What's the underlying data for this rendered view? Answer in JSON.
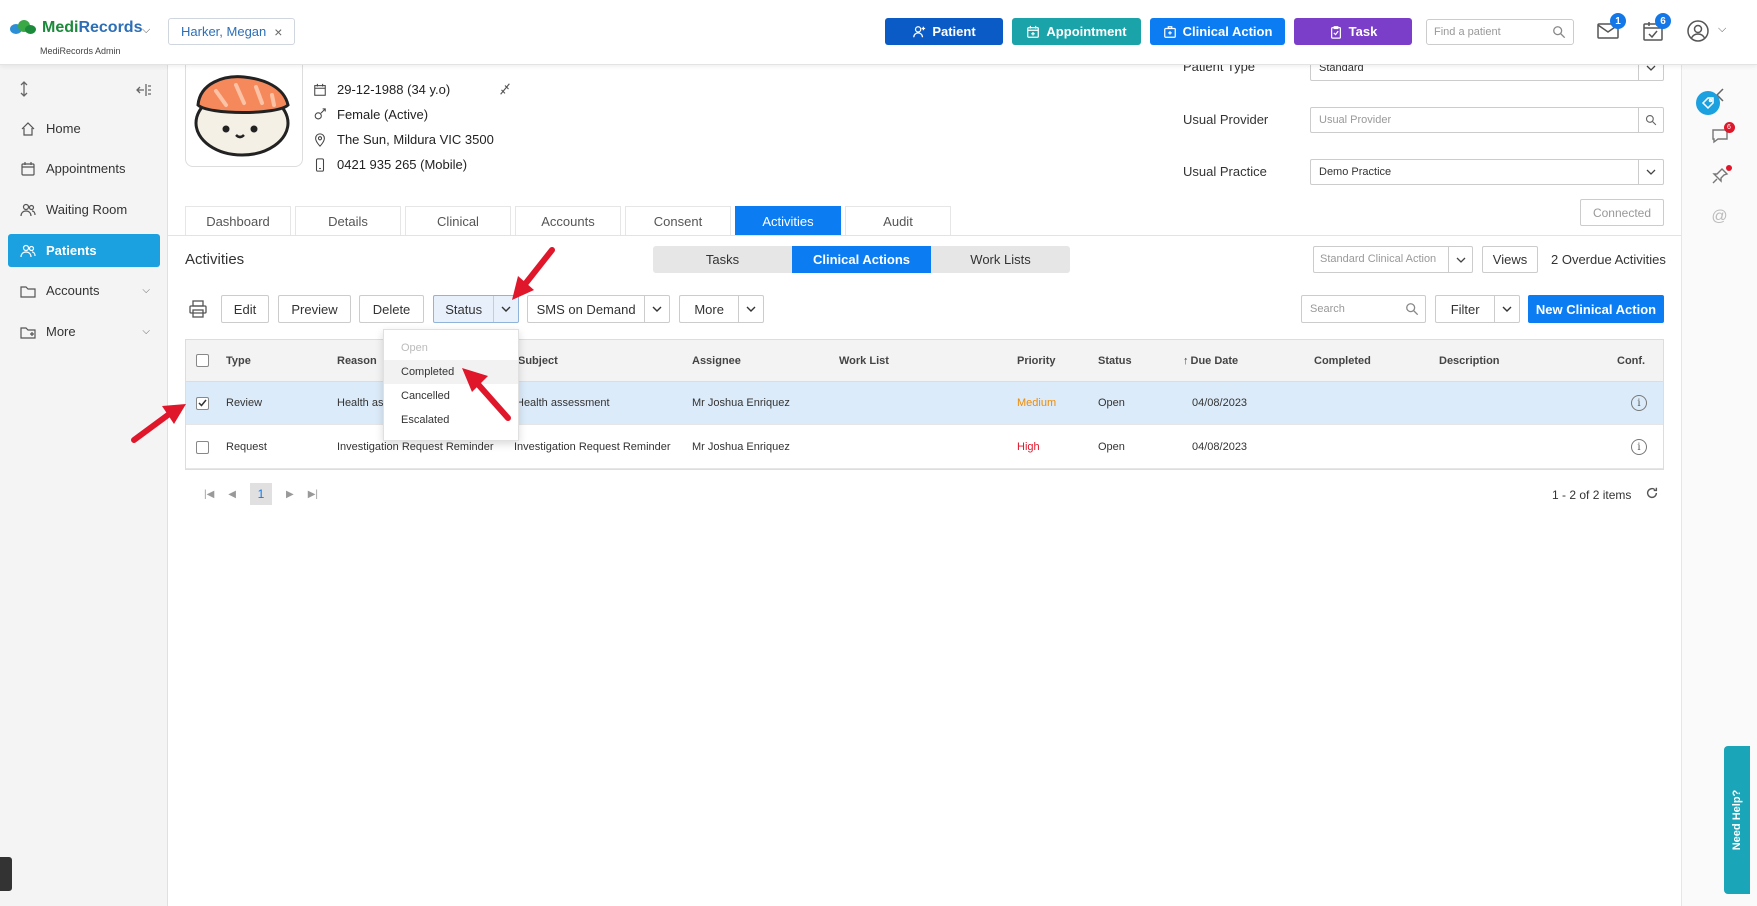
{
  "header": {
    "logo_part1": "Medi",
    "logo_part2": "Records",
    "logo_subtitle": "MediRecords Admin",
    "patient_chip": "Harker, Megan",
    "buttons": {
      "patient": "Patient",
      "appointment": "Appointment",
      "clinical_action": "Clinical Action",
      "task": "Task"
    },
    "find_placeholder": "Find a patient",
    "mail_count": "1",
    "tasks_count": "6",
    "colors": {
      "patient": "#0b5bc6",
      "appointment": "#1aa3a8",
      "clinical_action": "#0b7cf2",
      "task": "#7a3ec8"
    }
  },
  "sidebar": {
    "items": [
      {
        "label": "Home",
        "icon": "home-icon"
      },
      {
        "label": "Appointments",
        "icon": "calendar-icon"
      },
      {
        "label": "Waiting Room",
        "icon": "people-icon"
      },
      {
        "label": "Patients",
        "icon": "patients-icon"
      },
      {
        "label": "Accounts",
        "icon": "folder-icon"
      },
      {
        "label": "More",
        "icon": "more-icon"
      }
    ]
  },
  "patient": {
    "name": "Harker, Megan",
    "dob": "29-12-1988 (34 y.o)",
    "gender": "Female (Active)",
    "address": "The Sun, Mildura VIC 3500",
    "phone": "0421 935 265 (Mobile)",
    "patient_type_label": "Patient Type",
    "patient_type_value": "Standard",
    "usual_provider_label": "Usual Provider",
    "usual_provider_placeholder": "Usual Provider",
    "usual_practice_label": "Usual Practice",
    "usual_practice_value": "Demo Practice",
    "connected": "Connected"
  },
  "tabs": [
    "Dashboard",
    "Details",
    "Clinical",
    "Accounts",
    "Consent",
    "Activities",
    "Audit"
  ],
  "activities": {
    "title": "Activities",
    "segments": [
      "Tasks",
      "Clinical Actions",
      "Work Lists"
    ],
    "clinical_action_type": "Standard Clinical Action",
    "views": "Views",
    "overdue": "2 Overdue Activities",
    "toolbar": {
      "edit": "Edit",
      "preview": "Preview",
      "delete": "Delete",
      "status": "Status",
      "sms": "SMS on Demand",
      "more": "More",
      "search_placeholder": "Search",
      "filter": "Filter",
      "new_clinical_action": "New Clinical Action"
    },
    "status_options": [
      "Open",
      "Completed",
      "Cancelled",
      "Escalated"
    ],
    "columns": [
      "Type",
      "Reason",
      "Subject",
      "Assignee",
      "Work List",
      "Priority",
      "Status",
      "Due Date",
      "Completed",
      "Description",
      "Conf."
    ],
    "rows": [
      {
        "type": "Review",
        "reason": "Health assessment",
        "subject": "Health assessment",
        "assignee": "Mr Joshua Enriquez",
        "work_list": "",
        "priority": "Medium",
        "priority_color": "#f08a00",
        "status": "Open",
        "due": "04/08/2023",
        "completed": "",
        "description": ""
      },
      {
        "type": "Request",
        "reason": "Investigation Request Reminder",
        "subject": "Investigation Request Reminder",
        "assignee": "Mr Joshua Enriquez",
        "work_list": "",
        "priority": "High",
        "priority_color": "#e0162b",
        "status": "Open",
        "due": "04/08/2023",
        "completed": "",
        "description": ""
      }
    ],
    "pager": {
      "page": "1",
      "info": "1 - 2 of 2 items"
    }
  },
  "help": "Need Help?"
}
